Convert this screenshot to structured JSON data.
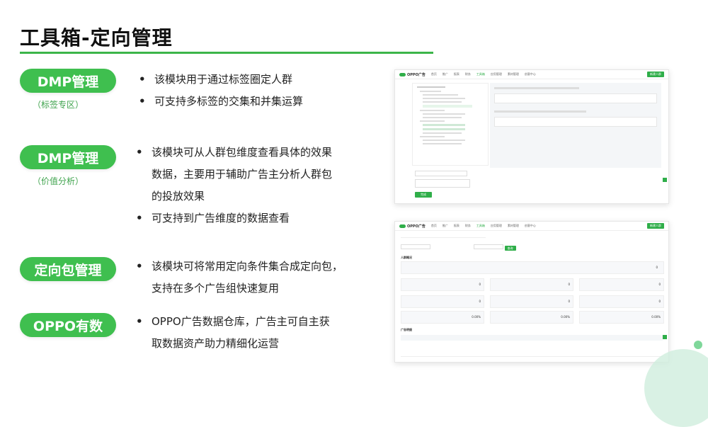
{
  "title": "工具箱-定向管理",
  "sections": [
    {
      "label": "DMP管理",
      "sub": "（标签专区）",
      "bullets": [
        "该模块用于通过标签圈定人群",
        "可支持多标签的交集和并集运算"
      ]
    },
    {
      "label": "DMP管理",
      "sub": "（价值分析）",
      "bullets": [
        "该模块可从人群包维度查看具体的效果",
        "数据，主要用于辅助广告主分析人群包",
        "的投放效果",
        "可支持到广告维度的数据查看"
      ]
    },
    {
      "label": "定向包管理",
      "bullets": [
        "该模块可将常用定向条件集合成定向包，",
        "支持在多个广告组快速复用"
      ]
    },
    {
      "label": "OPPO有数",
      "bullets": [
        "OPPO广告数据仓库，广告主可自主获",
        "取数据资产助力精细化运营"
      ]
    }
  ],
  "screenshot1": {
    "logo": "OPPO广告",
    "nav": [
      "首页",
      "推广",
      "报表",
      "财务",
      "工具箱",
      "应用管理",
      "素材管理",
      "创意中心"
    ],
    "button": "新建人群",
    "submit": "完成"
  },
  "screenshot2": {
    "logo": "OPPO广告",
    "nav": [
      "首页",
      "推广",
      "报表",
      "财务",
      "工具箱",
      "应用管理",
      "素材管理",
      "创意中心"
    ],
    "button": "查询",
    "section1": "人群概况",
    "section2": "广告明细",
    "stats": [
      {
        "value": "0"
      },
      {
        "value": "0"
      },
      {
        "value": "0"
      },
      {
        "value": "0"
      },
      {
        "value": "0"
      },
      {
        "value": "0"
      },
      {
        "value": "0"
      },
      {
        "value": "0.00%"
      },
      {
        "value": "0.00%"
      },
      {
        "value": "0.00%"
      }
    ]
  }
}
